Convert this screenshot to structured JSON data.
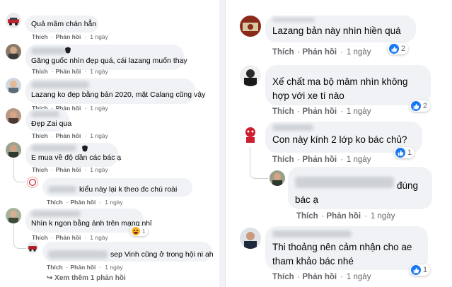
{
  "left_comments": [
    {
      "text": "Quả mâm chán hẳn",
      "actions": {
        "like": "Thích",
        "reply": "Phản hồi",
        "time": "1 ngày"
      }
    },
    {
      "text": "Găng guốc nhìn đẹp quá, cái lazang muốn thay",
      "actions": {
        "like": "Thích",
        "reply": "Phản hồi",
        "time": "1 ngày"
      }
    },
    {
      "text": "Lazang ko đẹp bằng bản 2020, mặt Calang cũng vậy",
      "actions": {
        "like": "Thích",
        "reply": "Phản hồi",
        "time": "1 ngày"
      }
    },
    {
      "text": "Đẹp Zai qua",
      "actions": {
        "like": "Thích",
        "reply": "Phản hồi",
        "time": "1 ngày"
      }
    },
    {
      "text": "E mua về độ dần các bác ạ",
      "actions": {
        "like": "Thích",
        "reply": "Phản hồi",
        "time": "1 ngày"
      }
    },
    {
      "text": "kiểu này lại k theo đc chú roài",
      "actions": {
        "like": "Thích",
        "reply": "Phản hồi",
        "time": "1 ngày"
      }
    },
    {
      "text": "Nhìn k ngon bằng ảnh trên mạng nhỉ",
      "reaction_count": "1",
      "actions": {
        "like": "Thích",
        "reply": "Phản hồi",
        "time": "1 ngày"
      }
    },
    {
      "text": "sep Vinh cũng ở trong hội ni ah",
      "actions": {
        "like": "Thích",
        "reply": "Phản hồi",
        "time": "1 ngày"
      }
    }
  ],
  "more_replies": "Xem thêm 1 phản hồi",
  "right_comments": [
    {
      "lines": [
        "Lazang bản này nhìn hiền quá"
      ],
      "reaction_count": "2",
      "actions": {
        "like": "Thích",
        "reply": "Phản hồi",
        "time": "1 ngày"
      }
    },
    {
      "lines": [
        "Xế chất ma bộ mâm nhìn không",
        "hợp với xe tí nào"
      ],
      "reaction_count": "2",
      "actions": {
        "like": "Thích",
        "reply": "Phản hồi",
        "time": "1 ngày"
      }
    },
    {
      "lines": [
        "Con này kính 2 lớp ko bác chủ?"
      ],
      "reaction_count": "1",
      "actions": {
        "like": "Thích",
        "reply": "Phản hồi",
        "time": "1 ngày"
      }
    },
    {
      "lines": [
        "đúng",
        "bác ạ"
      ],
      "actions": {
        "like": "Thích",
        "reply": "Phản hồi",
        "time": "1 ngày"
      }
    },
    {
      "lines": [
        "Thi thoảng nên cảm nhận cho ae",
        "tham khảo bác nhé"
      ],
      "reaction_count": "1",
      "actions": {
        "like": "Thích",
        "reply": "Phản hồi",
        "time": "1 ngày"
      }
    }
  ],
  "colors": {
    "like_blue": "#1877f2",
    "bubble_bg": "#f0f2f5",
    "meta_gray": "#65676b",
    "haha_yellow": "#f7b125"
  },
  "icons": [
    "user-avatar-icon",
    "like-reaction-icon",
    "haha-reaction-icon",
    "mask-badge-icon",
    "reply-arrow-icon"
  ]
}
